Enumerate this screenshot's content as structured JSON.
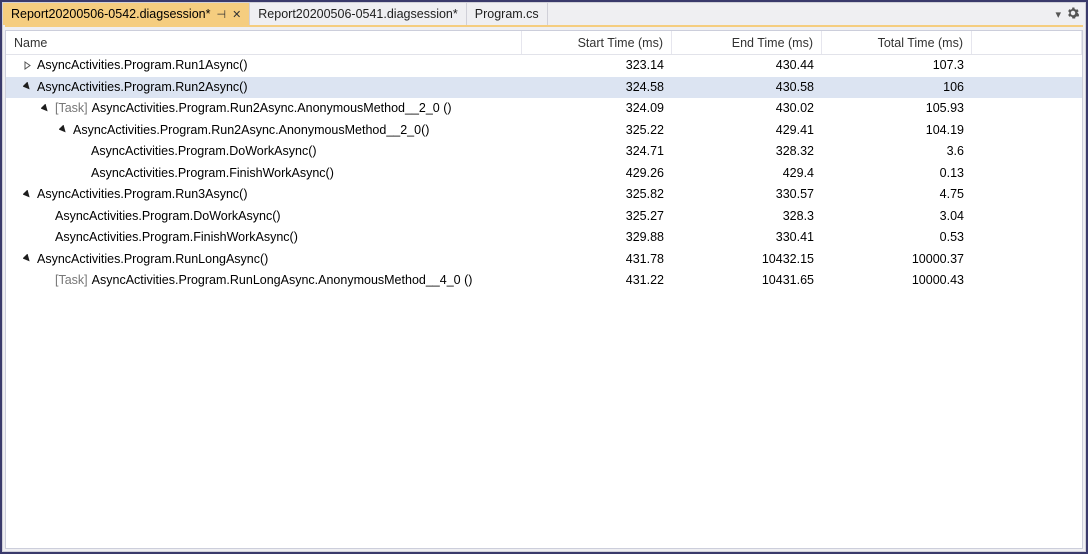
{
  "tabs": [
    {
      "label": "Report20200506-0542.diagsession*",
      "active": true,
      "pinned": true,
      "closable": true
    },
    {
      "label": "Report20200506-0541.diagsession*",
      "active": false,
      "pinned": false,
      "closable": false
    },
    {
      "label": "Program.cs",
      "active": false,
      "pinned": false,
      "closable": false
    }
  ],
  "columns": {
    "name": "Name",
    "start": "Start Time (ms)",
    "end": "End Time (ms)",
    "total": "Total Time (ms)"
  },
  "rows": [
    {
      "depth": 0,
      "expander": "closed",
      "task": false,
      "name": "AsyncActivities.Program.Run1Async()",
      "start": "323.14",
      "end": "430.44",
      "total": "107.3",
      "selected": false
    },
    {
      "depth": 0,
      "expander": "open",
      "task": false,
      "name": "AsyncActivities.Program.Run2Async()",
      "start": "324.58",
      "end": "430.58",
      "total": "106",
      "selected": true
    },
    {
      "depth": 1,
      "expander": "open",
      "task": true,
      "name": "AsyncActivities.Program.Run2Async.AnonymousMethod__2_0 ()",
      "start": "324.09",
      "end": "430.02",
      "total": "105.93",
      "selected": false
    },
    {
      "depth": 2,
      "expander": "open",
      "task": false,
      "name": "AsyncActivities.Program.Run2Async.AnonymousMethod__2_0()",
      "start": "325.22",
      "end": "429.41",
      "total": "104.19",
      "selected": false
    },
    {
      "depth": 3,
      "expander": "none",
      "task": false,
      "name": "AsyncActivities.Program.DoWorkAsync()",
      "start": "324.71",
      "end": "328.32",
      "total": "3.6",
      "selected": false
    },
    {
      "depth": 3,
      "expander": "none",
      "task": false,
      "name": "AsyncActivities.Program.FinishWorkAsync()",
      "start": "429.26",
      "end": "429.4",
      "total": "0.13",
      "selected": false
    },
    {
      "depth": 0,
      "expander": "open",
      "task": false,
      "name": "AsyncActivities.Program.Run3Async()",
      "start": "325.82",
      "end": "330.57",
      "total": "4.75",
      "selected": false
    },
    {
      "depth": 1,
      "expander": "none",
      "task": false,
      "name": "AsyncActivities.Program.DoWorkAsync()",
      "start": "325.27",
      "end": "328.3",
      "total": "3.04",
      "selected": false
    },
    {
      "depth": 1,
      "expander": "none",
      "task": false,
      "name": "AsyncActivities.Program.FinishWorkAsync()",
      "start": "329.88",
      "end": "330.41",
      "total": "0.53",
      "selected": false
    },
    {
      "depth": 0,
      "expander": "open",
      "task": false,
      "name": "AsyncActivities.Program.RunLongAsync()",
      "start": "431.78",
      "end": "10432.15",
      "total": "10000.37",
      "selected": false
    },
    {
      "depth": 1,
      "expander": "none",
      "task": true,
      "name": "AsyncActivities.Program.RunLongAsync.AnonymousMethod__4_0 ()",
      "start": "431.22",
      "end": "10431.65",
      "total": "10000.43",
      "selected": false
    }
  ],
  "task_prefix": "[Task]"
}
